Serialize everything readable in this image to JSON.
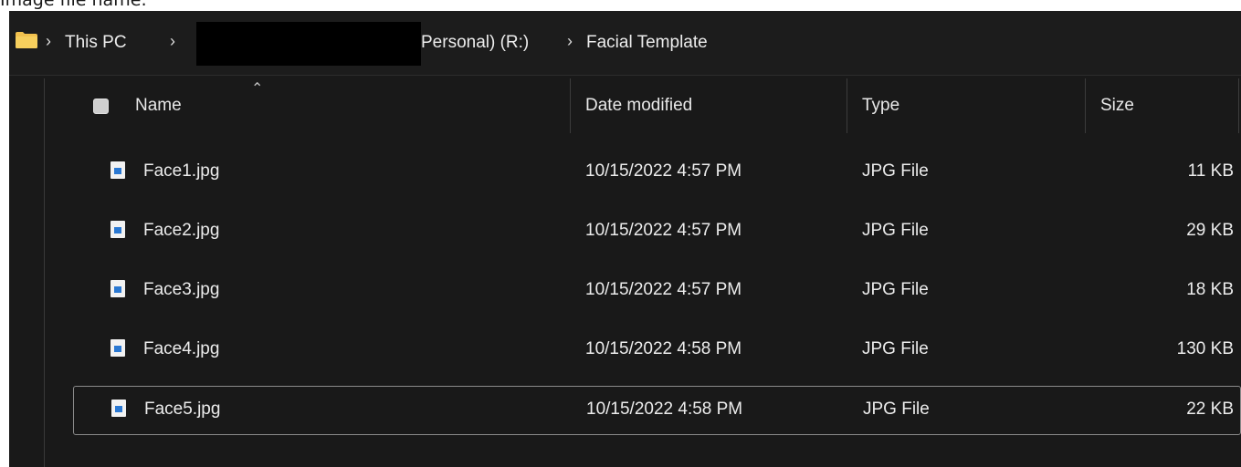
{
  "caption": "Image file name:",
  "address_bar": {
    "crumbs": [
      "This PC",
      "Personal) (R:)",
      "Facial Template"
    ]
  },
  "columns": {
    "name": "Name",
    "date_modified": "Date modified",
    "type": "Type",
    "size": "Size"
  },
  "files": [
    {
      "name": "Face1.jpg",
      "date": "10/15/2022 4:57 PM",
      "type": "JPG File",
      "size": "11 KB"
    },
    {
      "name": "Face2.jpg",
      "date": "10/15/2022 4:57 PM",
      "type": "JPG File",
      "size": "29 KB"
    },
    {
      "name": "Face3.jpg",
      "date": "10/15/2022 4:57 PM",
      "type": "JPG File",
      "size": "18 KB"
    },
    {
      "name": "Face4.jpg",
      "date": "10/15/2022 4:58 PM",
      "type": "JPG File",
      "size": "130 KB"
    },
    {
      "name": "Face5.jpg",
      "date": "10/15/2022 4:58 PM",
      "type": "JPG File",
      "size": "22 KB",
      "selected": true
    }
  ],
  "icons": {
    "folder": "folder-icon",
    "file": "image-file-icon",
    "sort": "sort-ascending-icon",
    "separator": "chevron-right-icon"
  },
  "colors": {
    "background": "#191919",
    "folder": "#f2c14e",
    "file_picture": "#2a78d2"
  }
}
